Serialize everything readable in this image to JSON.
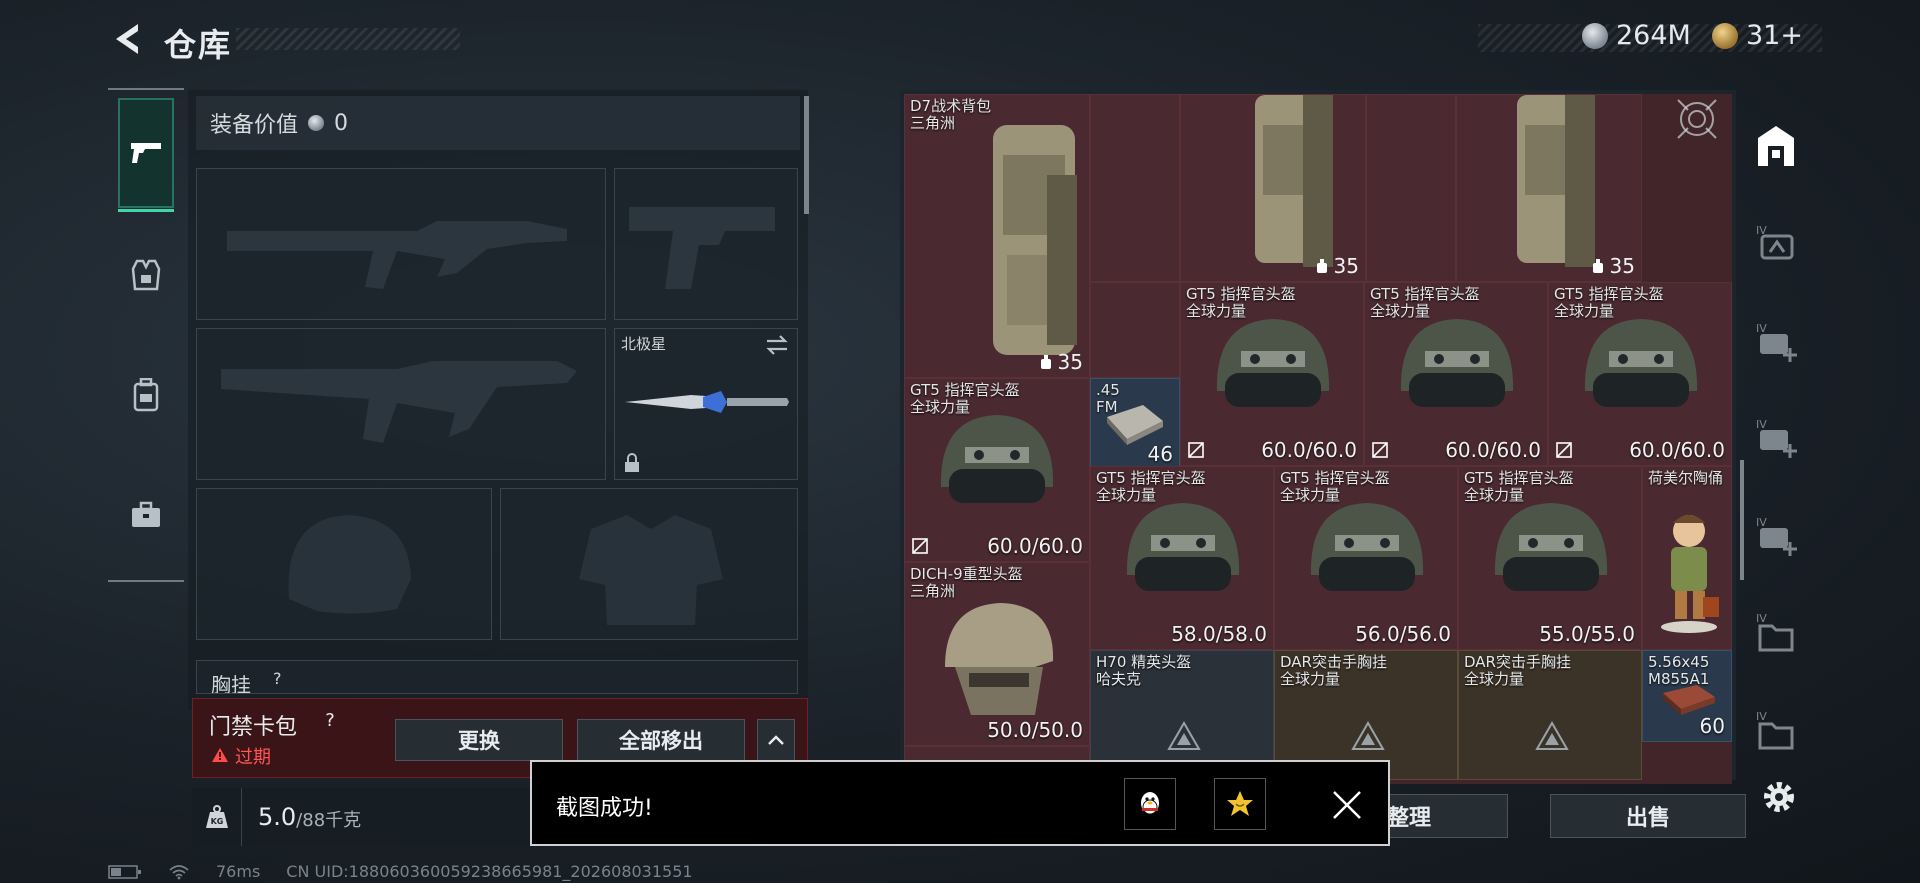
{
  "header": {
    "title": "仓库",
    "currencies": [
      {
        "icon": "silver-coin-icon",
        "value": "264M"
      },
      {
        "icon": "gold-coin-icon",
        "value": "31+"
      }
    ]
  },
  "loadout": {
    "equipment_value_label": "装备价值",
    "equipment_value": "0",
    "melee_name": "北极星",
    "chest_label_partial": "胸挂",
    "chest_help": "?"
  },
  "keycard": {
    "label": "门禁卡包",
    "help": "?",
    "status": "过期",
    "replace_button": "更换",
    "remove_all_button": "全部移出"
  },
  "weight": {
    "current": "5.0",
    "capacity": "/88千克"
  },
  "stash": {
    "items": [
      {
        "name": "D7战术背包",
        "sub": "三角洲",
        "qty": "35"
      },
      {
        "name": "",
        "sub": "",
        "qty": "35"
      },
      {
        "name": "",
        "sub": "",
        "qty": "35"
      },
      {
        "name": "GT5 指挥官头盔",
        "sub": "全球力量",
        "val": "60.0/60.0"
      },
      {
        "name": "GT5 指挥官头盔",
        "sub": "全球力量",
        "val": "60.0/60.0"
      },
      {
        "name": "GT5 指挥官头盔",
        "sub": "全球力量",
        "val": "60.0/60.0"
      },
      {
        "name": "GT5 指挥官头盔",
        "sub": "全球力量",
        "val": "60.0/60.0"
      },
      {
        "name": ".45",
        "sub": "FM",
        "val": "46"
      },
      {
        "name": "GT5 指挥官头盔",
        "sub": "全球力量",
        "val": "58.0/58.0"
      },
      {
        "name": "GT5 指挥官头盔",
        "sub": "全球力量",
        "val": "56.0/56.0"
      },
      {
        "name": "GT5 指挥官头盔",
        "sub": "全球力量",
        "val": "55.0/55.0"
      },
      {
        "name": "荷美尔陶俑",
        "sub": "",
        "val": ""
      },
      {
        "name": "DICH-9重型头盔",
        "sub": "三角洲",
        "val": "50.0/50.0"
      },
      {
        "name": "H70 精英头盔",
        "sub": "哈夫克",
        "val": ""
      },
      {
        "name": "DAR突击手胸挂",
        "sub": "全球力量",
        "val": ""
      },
      {
        "name": "DAR突击手胸挂",
        "sub": "全球力量",
        "val": ""
      },
      {
        "name": "5.56x45",
        "sub": "M855A1",
        "val": "60"
      }
    ]
  },
  "buttons": {
    "organize": "整理",
    "sell": "出售"
  },
  "toast": {
    "message": "截图成功!"
  },
  "status_bar": {
    "ping": "76ms",
    "uid": "CN UID:18806036005923866598​1_202608031551"
  }
}
